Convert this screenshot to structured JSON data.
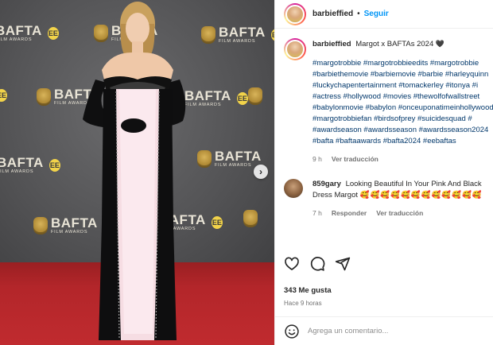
{
  "photo": {
    "logo": {
      "word": "BAFTA",
      "sub": "FILM AWARDS",
      "ee": "EE"
    },
    "next_glyph": "›"
  },
  "post": {
    "username": "barbieffied",
    "separator": "•",
    "follow_label": "Seguir",
    "caption_user": "barbieffied",
    "caption_text": "Margot x BAFTAs 2024",
    "caption_heart": "🖤",
    "hashtags": "#margotrobbie #margotrobbieedits #margotrobbie\n#barbiethemovie #barbiemovie #barbie #harleyquinn\n#luckychapentertainment #tomackerley #itonya #i\n#actress #hollywood #movies #thewolfofwallstreet\n#babylonmovie #babylon #onceuponatimeinhollywood\n#margotrobbiefan #birdsofprey #suicidesquad #\n#awardseason #awardsseason #awardsseason2024\n#bafta #baftaawards #bafta2024 #eebaftas",
    "caption_time": "9 h",
    "caption_translate": "Ver traducción",
    "comment": {
      "user": "859gary",
      "text": "Looking Beautiful In Your Pink And Black Dress Margot",
      "emoji": "🥰🥰🥰🥰🥰🥰🥰🥰🥰🥰🥰🥰",
      "time": "7 h",
      "reply": "Responder",
      "translate": "Ver traducción"
    },
    "likes": "343 Me gusta",
    "time_ago": "Hace 9 horas",
    "comment_placeholder": "Agrega un comentario..."
  },
  "colors": {
    "follow_blue": "#0095f6",
    "hashtag_blue": "#00376b",
    "meta_gray": "#737373",
    "carpet_red": "#b3262a"
  },
  "icons": [
    "heart-icon",
    "comment-icon",
    "share-icon",
    "emoji-icon",
    "chevron-right-icon",
    "bafta-mask-icon"
  ]
}
